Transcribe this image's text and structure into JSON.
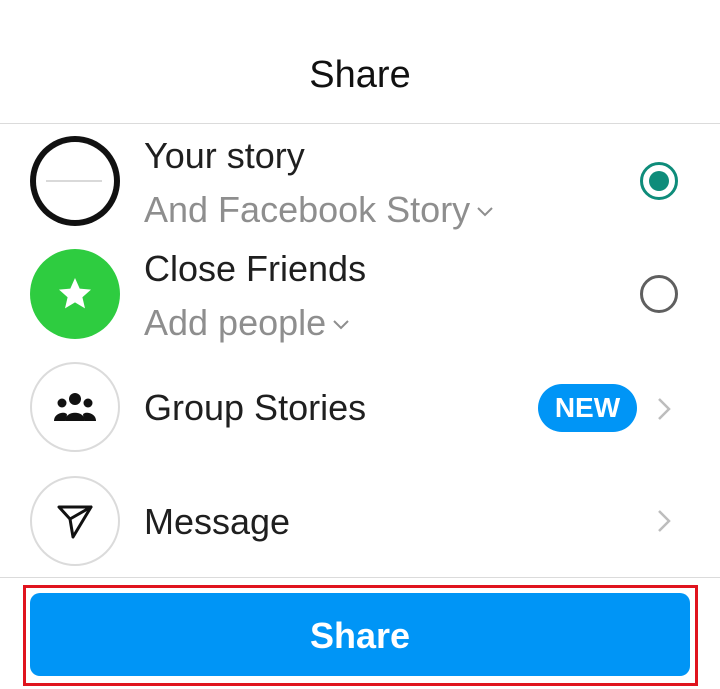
{
  "header": {
    "title": "Share"
  },
  "rows": [
    {
      "title": "Your story",
      "subtitle": "And Facebook Story",
      "control": "radio",
      "checked": true,
      "avatar": "profile-photo"
    },
    {
      "title": "Close Friends",
      "subtitle": "Add people",
      "control": "radio",
      "checked": false,
      "avatar": "star-icon"
    },
    {
      "title": "Group Stories",
      "badge": "NEW",
      "control": "chevron",
      "avatar": "group-icon"
    },
    {
      "title": "Message",
      "control": "chevron",
      "avatar": "send-icon"
    }
  ],
  "footer": {
    "button_label": "Share"
  },
  "colors": {
    "accent_blue": "#0095f6",
    "radio_green": "#0e8c7a",
    "close_friends_green": "#2ecc40",
    "highlight_red": "#e0141e"
  }
}
